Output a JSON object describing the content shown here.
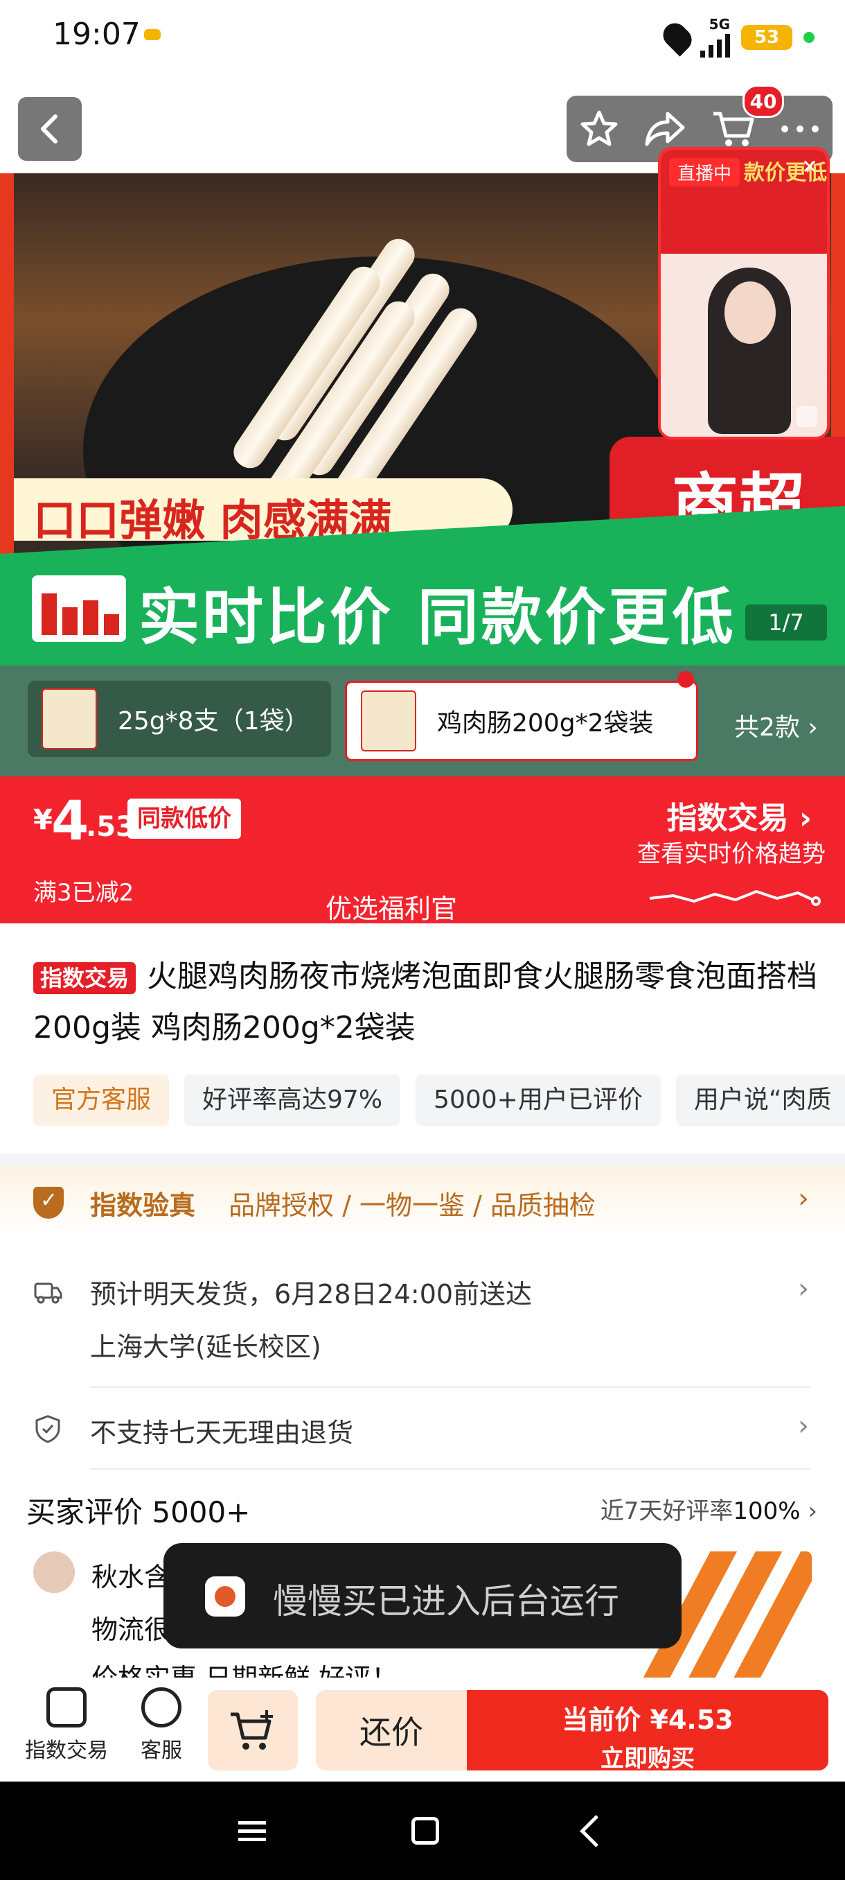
{
  "status_bar": {
    "time": "19:07",
    "network": "5G",
    "battery": "53"
  },
  "header": {
    "cart_count": "40"
  },
  "hero": {
    "slogan": "口口弹嫩 肉感满满",
    "side_text": "商超",
    "banner_text": "实时比价 同款价更低",
    "page_indicator": "1/7",
    "live": {
      "tag": "直播中",
      "title": "款价更低"
    }
  },
  "sku": {
    "options": [
      "25g*8支（1袋）",
      "鸡肉肠200g*2袋装"
    ],
    "more": "共2款 ›"
  },
  "price": {
    "currency": "¥",
    "integer": "4",
    "decimal": ".53",
    "tag": "同款低价",
    "promo": "满3已减2",
    "welfare": "优选福利官",
    "index_label": "指数交易 ›",
    "index_sub": "查看实时价格趋势"
  },
  "product": {
    "title_tag": "指数交易",
    "title": "火腿鸡肉肠夜市烧烤泡面即食火腿肠零食泡面搭档200g装 鸡肉肠200g*2袋装",
    "chips": [
      "官方客服",
      "好评率高达97%",
      "5000+用户已评价",
      "用户说“肉质"
    ]
  },
  "verify": {
    "name": "指数验真",
    "desc": "品牌授权 / 一物一鉴 / 品质抽检"
  },
  "delivery": {
    "line1": "预计明天发货，6月28日24:00前送达",
    "line2": "上海大学(延长校区)"
  },
  "return_policy": "不支持七天无理由退货",
  "reviews": {
    "heading": "买家评价 5000+",
    "rate_label": "近7天好评率",
    "rate_value": "100%",
    "reviewer": "秋水含",
    "line1": "物流很",
    "line2": "价格实惠  日期新鲜  好评！"
  },
  "toast": {
    "message": "慢慢买已进入后台运行"
  },
  "bottom_bar": {
    "index_trade": "指数交易",
    "service": "客服",
    "bargain": "还价",
    "buy_line1": "当前价 ¥4.53",
    "buy_line2": "立即购买"
  },
  "colors": {
    "brand_red": "#f3232e",
    "green": "#19b25b",
    "gold": "#b96b1e"
  }
}
